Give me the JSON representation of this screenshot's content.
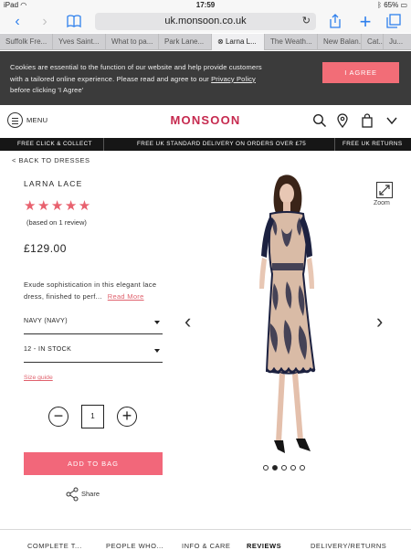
{
  "status_bar": {
    "device": "iPad",
    "time": "17:59",
    "battery": "65%"
  },
  "browser": {
    "url": "uk.monsoon.co.uk",
    "tabs": [
      {
        "label": "Suffolk Fre..."
      },
      {
        "label": "Yves Saint..."
      },
      {
        "label": "What to pa..."
      },
      {
        "label": "Park Lane..."
      },
      {
        "label": "Larna L...",
        "active": true
      },
      {
        "label": "The Weath..."
      },
      {
        "label": "New Balan..."
      },
      {
        "label": "Cat..."
      },
      {
        "label": "Ju..."
      }
    ]
  },
  "cookie_banner": {
    "line1": "Cookies are essential to the function of our website and help provide customers",
    "line2": "with a tailored online experience. Please read and agree to our ",
    "link": "Privacy Policy",
    "line3": "before clicking 'I Agree'",
    "agree_label": "I AGREE"
  },
  "header": {
    "menu_label": "MENU",
    "logo": "MONSOON"
  },
  "promo": {
    "left": "FREE CLICK & COLLECT",
    "center": "FREE UK STANDARD DELIVERY ON ORDERS OVER £75",
    "right": "FREE UK RETURNS"
  },
  "product": {
    "back_link": "< BACK TO DRESSES",
    "name": "LARNA LACE",
    "rating": 5,
    "stars": "★★★★★",
    "reviews_text": "(based on 1 review)",
    "price": "£129.00",
    "description": "Exude sophistication in this elegant lace dress, finished to perf...",
    "read_more": "Read More",
    "colour_select": "NAVY (NAVY)",
    "size_select": "12 - IN STOCK",
    "size_guide": "Size guide",
    "quantity": "1",
    "add_to_bag": "ADD TO BAG",
    "share": "Share",
    "zoom_label": "Zoom",
    "gallery_count": 5,
    "gallery_active": 2
  },
  "bottom_tabs": [
    "COMPLETE T...",
    "PEOPLE WHO...",
    "INFO & CARE",
    "REVIEWS",
    "DELIVERY/RETURNS"
  ],
  "colors": {
    "brand": "#c62a4f",
    "accent": "#f2677a",
    "dress": "#1c2140"
  }
}
